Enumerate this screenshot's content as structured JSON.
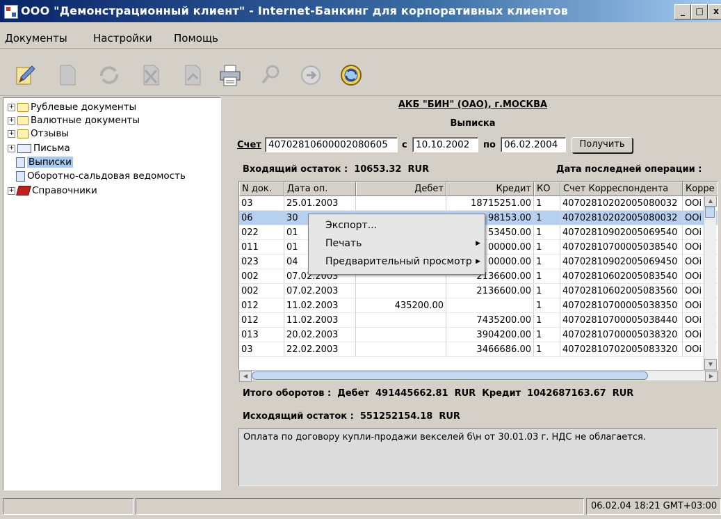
{
  "window": {
    "title": "ООО \"Демонстрационный клиент\" - Internet-Банкинг для корпоративных клиентов",
    "minimize": "_",
    "maximize": "□",
    "close": "x"
  },
  "menu": [
    "Документы",
    "Настройки",
    "Помощь"
  ],
  "toolbar": {
    "icons": [
      "edit-icon",
      "document-icon",
      "refresh-icon",
      "delete-icon",
      "sign-icon",
      "printer-icon",
      "search-icon",
      "send-icon",
      "receive-icon"
    ]
  },
  "tree": {
    "items": [
      {
        "label": "Рублевые документы",
        "expander": "+"
      },
      {
        "label": "Валютные документы",
        "expander": "+"
      },
      {
        "label": "Отзывы",
        "expander": "+"
      },
      {
        "label": "Письма",
        "expander": "+"
      },
      {
        "label": "Выписки",
        "expander": ""
      },
      {
        "label": "Оборотно-сальдовая ведомость",
        "expander": ""
      },
      {
        "label": "Справочники",
        "expander": "+"
      }
    ]
  },
  "statement": {
    "bank": "АКБ \"БИН\" (ОАО), г.МОСКВА",
    "title": "Выписка",
    "account_label": "Счет",
    "account": "40702810600002080605",
    "from_label": "с",
    "from_date": "10.10.2002",
    "to_label": "по",
    "to_date": "06.02.2004",
    "get_button": "Получить",
    "opening_balance": "Входящий остаток :  10653.32  RUR",
    "last_operation": "Дата последней операции :",
    "totals": "Итого оборотов :  Дебет  491445662.81  RUR  Кредит  1042687163.67  RUR",
    "closing_balance": "Исходящий остаток :  551252154.18  RUR",
    "comment": "Оплата по договору купли-продажи векселей б\\н от 30.01.03 г. НДС не облагается."
  },
  "table": {
    "columns": [
      "N док.",
      "Дата оп.",
      "Дебет",
      "Кредит",
      "КО",
      "Счет Корреспондента",
      "Корре"
    ],
    "rows": [
      [
        "03",
        "25.01.2003",
        "",
        "18715251.00",
        "1",
        "40702810202005080032",
        "ООі"
      ],
      [
        "06",
        "30",
        "",
        "98153.00",
        "1",
        "40702810202005080032",
        "ООі"
      ],
      [
        "022",
        "01",
        "",
        "53450.00",
        "1",
        "40702810902005069540",
        "ООі"
      ],
      [
        "011",
        "01",
        "",
        "00000.00",
        "1",
        "40702810700005038540",
        "ООі"
      ],
      [
        "023",
        "04",
        "",
        "00000.00",
        "1",
        "40702810902005069450",
        "ООі"
      ],
      [
        "002",
        "07.02.2003",
        "",
        "2136600.00",
        "1",
        "40702810602005083540",
        "ООі"
      ],
      [
        "002",
        "07.02.2003",
        "",
        "2136600.00",
        "1",
        "40702810602005083560",
        "ООі"
      ],
      [
        "012",
        "11.02.2003",
        "435200.00",
        "",
        "1",
        "40702810700005038350",
        "ООі"
      ],
      [
        "012",
        "11.02.2003",
        "",
        "7435200.00",
        "1",
        "40702810700005038440",
        "ООі"
      ],
      [
        "013",
        "20.02.2003",
        "",
        "3904200.00",
        "1",
        "40702810700005038320",
        "ООі"
      ],
      [
        "03",
        "22.02.2003",
        "",
        "3466686.00",
        "1",
        "40702810702005083320",
        "ООі"
      ]
    ]
  },
  "context_menu": {
    "items": [
      {
        "label": "Экспорт...",
        "arrow": ""
      },
      {
        "label": "Печать",
        "arrow": "▶"
      },
      {
        "label": "Предварительный просмотр",
        "arrow": "▶"
      }
    ]
  },
  "status": {
    "left": "",
    "middle": "",
    "datetime": "06.02.04 18:21 GMT+03:00"
  }
}
